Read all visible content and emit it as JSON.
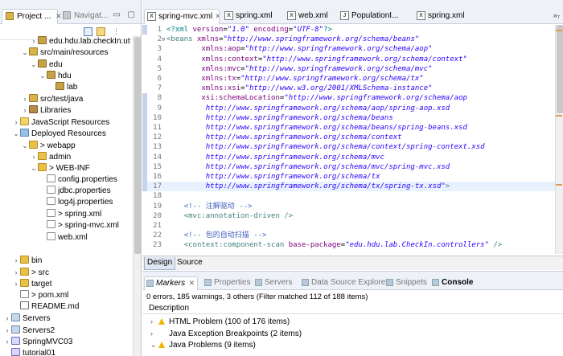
{
  "left": {
    "tabs": [
      {
        "label": "Project ...",
        "active": true
      },
      {
        "label": "Navigat...",
        "active": false
      }
    ],
    "tree": [
      {
        "indent": 3,
        "twisty": ">",
        "icon": "i-pkg",
        "label": "edu.hdu.lab.checkIn.ut"
      },
      {
        "indent": 2,
        "twisty": "v",
        "icon": "i-srcf",
        "label": "src/main/resources"
      },
      {
        "indent": 3,
        "twisty": "v",
        "icon": "i-pkg",
        "label": "edu"
      },
      {
        "indent": 4,
        "twisty": "v",
        "icon": "i-pkg",
        "label": "hdu"
      },
      {
        "indent": 5,
        "twisty": "",
        "icon": "i-pkg",
        "label": "lab"
      },
      {
        "indent": 2,
        "twisty": ">",
        "icon": "i-srcf",
        "label": "src/test/java"
      },
      {
        "indent": 2,
        "twisty": ">",
        "icon": "i-lib",
        "label": "Libraries"
      },
      {
        "indent": 1,
        "twisty": ">",
        "icon": "i-js",
        "label": "JavaScript Resources"
      },
      {
        "indent": 1,
        "twisty": "v",
        "icon": "i-dep",
        "label": "Deployed Resources"
      },
      {
        "indent": 2,
        "twisty": "v",
        "icon": "i-folder",
        "label": "> webapp"
      },
      {
        "indent": 3,
        "twisty": ">",
        "icon": "i-folder",
        "label": "admin"
      },
      {
        "indent": 3,
        "twisty": "v",
        "icon": "i-folder",
        "label": "> WEB-INF"
      },
      {
        "indent": 4,
        "twisty": "",
        "icon": "i-file",
        "label": "config.properties"
      },
      {
        "indent": 4,
        "twisty": "",
        "icon": "i-file",
        "label": "jdbc.properties"
      },
      {
        "indent": 4,
        "twisty": "",
        "icon": "i-file",
        "label": "log4j.properties"
      },
      {
        "indent": 4,
        "twisty": "",
        "icon": "i-xml",
        "label": "> spring.xml"
      },
      {
        "indent": 4,
        "twisty": "",
        "icon": "i-xml",
        "label": "> spring-mvc.xml"
      },
      {
        "indent": 4,
        "twisty": "",
        "icon": "i-xml",
        "label": "web.xml"
      },
      {
        "indent": 1,
        "twisty": "",
        "icon": "",
        "label": ""
      },
      {
        "indent": 1,
        "twisty": ">",
        "icon": "i-folder",
        "label": "bin"
      },
      {
        "indent": 1,
        "twisty": ">",
        "icon": "i-folder",
        "label": "> src"
      },
      {
        "indent": 1,
        "twisty": ">",
        "icon": "i-folder",
        "label": "target"
      },
      {
        "indent": 1,
        "twisty": "",
        "icon": "i-xml",
        "label": "> pom.xml"
      },
      {
        "indent": 1,
        "twisty": "",
        "icon": "i-md",
        "label": "README.md"
      },
      {
        "indent": 0,
        "twisty": ">",
        "icon": "i-srv",
        "label": "Servers"
      },
      {
        "indent": 0,
        "twisty": ">",
        "icon": "i-srv",
        "label": "Servers2"
      },
      {
        "indent": 0,
        "twisty": ">",
        "icon": "i-proj",
        "label": "SpringMVC03"
      },
      {
        "indent": 0,
        "twisty": "",
        "icon": "i-proj",
        "label": "tutorial01"
      }
    ]
  },
  "editor": {
    "tabs": [
      {
        "label": "spring-mvc.xml",
        "active": true,
        "icon": "X"
      },
      {
        "label": "spring.xml",
        "active": false,
        "icon": "X"
      },
      {
        "label": "web.xml",
        "active": false,
        "icon": "X"
      },
      {
        "label": "PopulationI...",
        "active": false,
        "icon": "J"
      },
      {
        "label": "spring.xml",
        "active": false,
        "icon": "X"
      }
    ],
    "overflow_label": "»₇",
    "lines": [
      {
        "n": "1",
        "parts": [
          [
            "t-pi",
            "<?xml "
          ],
          [
            "t-attr",
            "version"
          ],
          [
            "t-txt",
            "="
          ],
          [
            "t-str",
            "\"1.0\""
          ],
          [
            "t-txt",
            " "
          ],
          [
            "t-attr",
            "encoding"
          ],
          [
            "t-txt",
            "="
          ],
          [
            "t-str",
            "\"UTF-8\""
          ],
          [
            "t-pi",
            "?>"
          ]
        ]
      },
      {
        "n": "2",
        "fold": "⊖",
        "parts": [
          [
            "t-tag",
            "<beans "
          ],
          [
            "t-attr",
            "xmlns"
          ],
          [
            "t-txt",
            "="
          ],
          [
            "t-str",
            "\"http://www.springframework.org/schema/beans\""
          ]
        ]
      },
      {
        "n": "3",
        "parts": [
          [
            "t-txt",
            "        "
          ],
          [
            "t-attr",
            "xmlns:aop"
          ],
          [
            "t-txt",
            "="
          ],
          [
            "t-str",
            "\"http://www.springframework.org/schema/aop\""
          ]
        ]
      },
      {
        "n": "4",
        "parts": [
          [
            "t-txt",
            "        "
          ],
          [
            "t-attr",
            "xmlns:context"
          ],
          [
            "t-txt",
            "="
          ],
          [
            "t-str",
            "\"http://www.springframework.org/schema/context\""
          ]
        ]
      },
      {
        "n": "5",
        "parts": [
          [
            "t-txt",
            "        "
          ],
          [
            "t-attr",
            "xmlns:mvc"
          ],
          [
            "t-txt",
            "="
          ],
          [
            "t-str",
            "\"http://www.springframework.org/schema/mvc\""
          ]
        ]
      },
      {
        "n": "6",
        "parts": [
          [
            "t-txt",
            "        "
          ],
          [
            "t-attr",
            "xmlns:tx"
          ],
          [
            "t-txt",
            "="
          ],
          [
            "t-str",
            "\"http://www.springframework.org/schema/tx\""
          ]
        ]
      },
      {
        "n": "7",
        "parts": [
          [
            "t-txt",
            "        "
          ],
          [
            "t-attr",
            "xmlns:xsi"
          ],
          [
            "t-txt",
            "="
          ],
          [
            "t-str",
            "\"http://www.w3.org/2001/XMLSchema-instance\""
          ]
        ]
      },
      {
        "n": "8",
        "parts": [
          [
            "t-txt",
            "        "
          ],
          [
            "t-attr",
            "xsi:schemaLocation"
          ],
          [
            "t-txt",
            "="
          ],
          [
            "t-str",
            "\"http://www.springframework.org/schema/aop"
          ]
        ]
      },
      {
        "n": "9",
        "parts": [
          [
            "t-str",
            "         http://www.springframework.org/schema/aop/spring-aop.xsd"
          ]
        ]
      },
      {
        "n": "10",
        "parts": [
          [
            "t-str",
            "         http://www.springframework.org/schema/beans"
          ]
        ]
      },
      {
        "n": "11",
        "parts": [
          [
            "t-str",
            "         http://www.springframework.org/schema/beans/spring-beans.xsd"
          ]
        ]
      },
      {
        "n": "12",
        "parts": [
          [
            "t-str",
            "         http://www.springframework.org/schema/context"
          ]
        ]
      },
      {
        "n": "13",
        "parts": [
          [
            "t-str",
            "         http://www.springframework.org/schema/context/spring-context.xsd"
          ]
        ]
      },
      {
        "n": "14",
        "parts": [
          [
            "t-str",
            "         http://www.springframework.org/schema/mvc"
          ]
        ]
      },
      {
        "n": "15",
        "parts": [
          [
            "t-str",
            "         http://www.springframework.org/schema/mvc/spring-mvc.xsd"
          ]
        ]
      },
      {
        "n": "16",
        "parts": [
          [
            "t-str",
            "         http://www.springframework.org/schema/tx"
          ]
        ]
      },
      {
        "n": "17",
        "hl": true,
        "parts": [
          [
            "t-str",
            "         http://www.springframework.org/schema/tx/spring-tx.xsd\""
          ],
          [
            "t-tag",
            ">"
          ]
        ]
      },
      {
        "n": "18",
        "parts": []
      },
      {
        "n": "19",
        "parts": [
          [
            "t-txt",
            "    "
          ],
          [
            "t-cmt",
            "<!-- 注解驱动 -->"
          ]
        ]
      },
      {
        "n": "20",
        "parts": [
          [
            "t-txt",
            "    "
          ],
          [
            "t-tag",
            "<mvc:annotation-driven />"
          ]
        ]
      },
      {
        "n": "21",
        "parts": []
      },
      {
        "n": "22",
        "parts": [
          [
            "t-txt",
            "    "
          ],
          [
            "t-cmt",
            "<!-- 包的自动扫描 -->"
          ]
        ]
      },
      {
        "n": "23",
        "parts": [
          [
            "t-txt",
            "    "
          ],
          [
            "t-tag",
            "<context:component-scan "
          ],
          [
            "t-attr",
            "base-package"
          ],
          [
            "t-txt",
            "="
          ],
          [
            "t-str",
            "\"edu.hdu.lab.CheckIn.controllers\""
          ],
          [
            "t-tag",
            " />"
          ]
        ]
      }
    ],
    "design_tab": "Design",
    "source_tab": "Source"
  },
  "bottom": {
    "tabs": [
      {
        "label": "Markers",
        "on": true
      },
      {
        "label": "Properties",
        "on": false
      },
      {
        "label": "Servers",
        "on": false
      },
      {
        "label": "Data Source Explorer",
        "on": false
      },
      {
        "label": "Snippets",
        "on": false
      },
      {
        "label": "Console",
        "on": false
      }
    ],
    "status": "0 errors, 185 warnings, 3 others (Filter matched 112 of 188 items)",
    "column_header": "Description",
    "rows": [
      {
        "label": "HTML Problem (100 of 176 items)",
        "twisty": ">",
        "warn": true
      },
      {
        "label": "Java Exception Breakpoints (2 items)",
        "twisty": ">",
        "warn": false
      },
      {
        "label": "Java Problems (9 items)",
        "twisty": "v",
        "warn": true
      }
    ]
  }
}
